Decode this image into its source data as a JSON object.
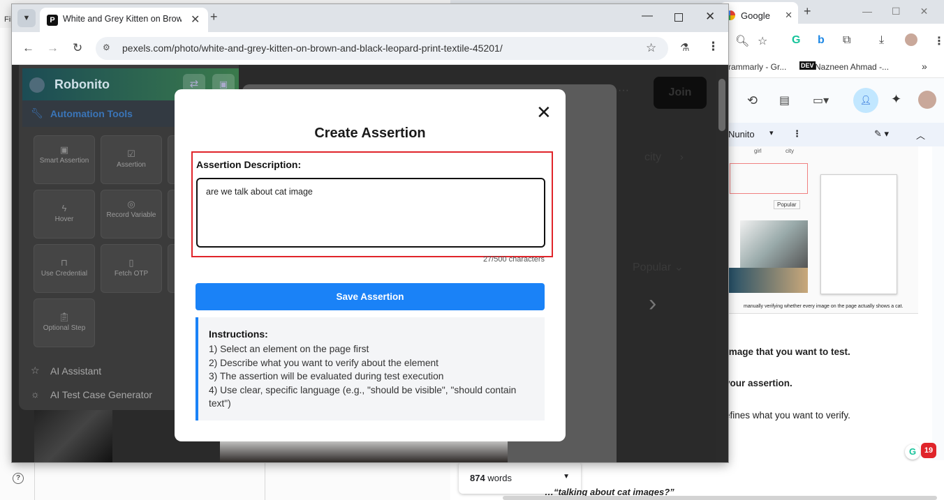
{
  "background_left": {
    "file_label": "Fil",
    "help_icon_glyph": "?"
  },
  "background_right": {
    "tab_title": "Google",
    "bookmarks": [
      "rammarly - Gr...",
      "DEV",
      "Nazneen Ahmad -..."
    ],
    "doc_toolbar": {
      "font_name": "Nunito"
    },
    "doc_lines": [
      "image that you want to test.",
      "your assertion.",
      "efines what you want to verify.",
      "…“talking about cat images?”"
    ],
    "thumbnail_caption": "manually verifying whether every image on the page actually shows a cat.",
    "thumbnail_tags": [
      "girl",
      "city"
    ],
    "thumbnail_popular": "Popular",
    "word_count": {
      "value": "874",
      "unit": "words"
    },
    "notification_count": "19"
  },
  "browser": {
    "tab": {
      "title": "White and Grey Kitten on Brown and Black Leopard Print Textile"
    },
    "url": "pexels.com/photo/white-and-grey-kitten-on-brown-and-black-leopard-print-textile-45201/"
  },
  "pexels": {
    "join_label": "Join",
    "city_label": "city",
    "popular_label": "Popular"
  },
  "robonito": {
    "title": "Robonito",
    "section_label": "Automation Tools",
    "tools": [
      {
        "label": "Smart Assertion",
        "icon": "smart-assertion-icon"
      },
      {
        "label": "Assertion",
        "icon": "checkbox-icon"
      },
      {
        "label": "Hover",
        "icon": "bolt-icon"
      },
      {
        "label": "Record Variable",
        "icon": "target-icon"
      },
      {
        "label": "Use Credential",
        "icon": "lock-icon"
      },
      {
        "label": "Fetch OTP",
        "icon": "phone-icon"
      },
      {
        "label": "Optional Step",
        "icon": "clipboard-icon"
      }
    ],
    "links": [
      {
        "label": "AI Assistant",
        "icon": "star-outline-icon"
      },
      {
        "label": "AI Test Case Generator",
        "icon": "sun-icon"
      }
    ]
  },
  "modal": {
    "title": "Create Assertion",
    "description_label": "Assertion Description:",
    "description_value": "are we talk about cat image",
    "char_count": "27/500 characters",
    "save_label": "Save Assertion",
    "instructions_title": "Instructions:",
    "instructions": [
      "1) Select an element on the page first",
      "2) Describe what you want to verify about the element",
      "3) The assertion will be evaluated during test execution",
      "4) Use clear, specific language (e.g., \"should be visible\", \"should contain text\")"
    ]
  },
  "colors": {
    "accent_blue": "#1a82f7",
    "highlight_red": "#e0242a"
  }
}
